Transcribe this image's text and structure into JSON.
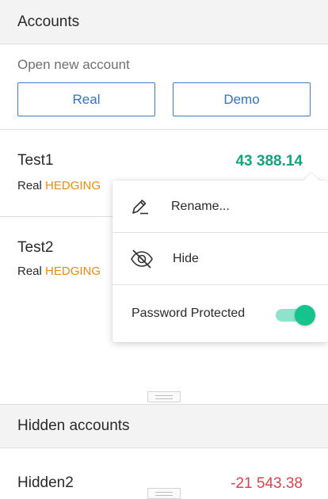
{
  "accounts_section": {
    "title": "Accounts"
  },
  "open_new": {
    "caption": "Open new account",
    "real_label": "Real",
    "demo_label": "Demo"
  },
  "accounts": [
    {
      "name": "Test1",
      "mode": "Real",
      "type": "HEDGING",
      "balance": "43 388.14"
    },
    {
      "name": "Test2",
      "mode": "Real",
      "type": "HEDGING"
    }
  ],
  "context_menu": {
    "rename_label": "Rename...",
    "hide_label": "Hide",
    "password_label": "Password Protected",
    "password_protected": true,
    "icons": {
      "rename": "pencil-icon",
      "hide": "eye-slash-icon"
    }
  },
  "hidden_section": {
    "title": "Hidden accounts",
    "accounts": [
      {
        "name": "Hidden2",
        "balance": "-21 543.38"
      }
    ]
  },
  "colors": {
    "accent_blue": "#2f74c0",
    "positive": "#12a37f",
    "negative": "#e0414b",
    "hedging": "#f0890f",
    "toggle_on": "#14c48c"
  }
}
